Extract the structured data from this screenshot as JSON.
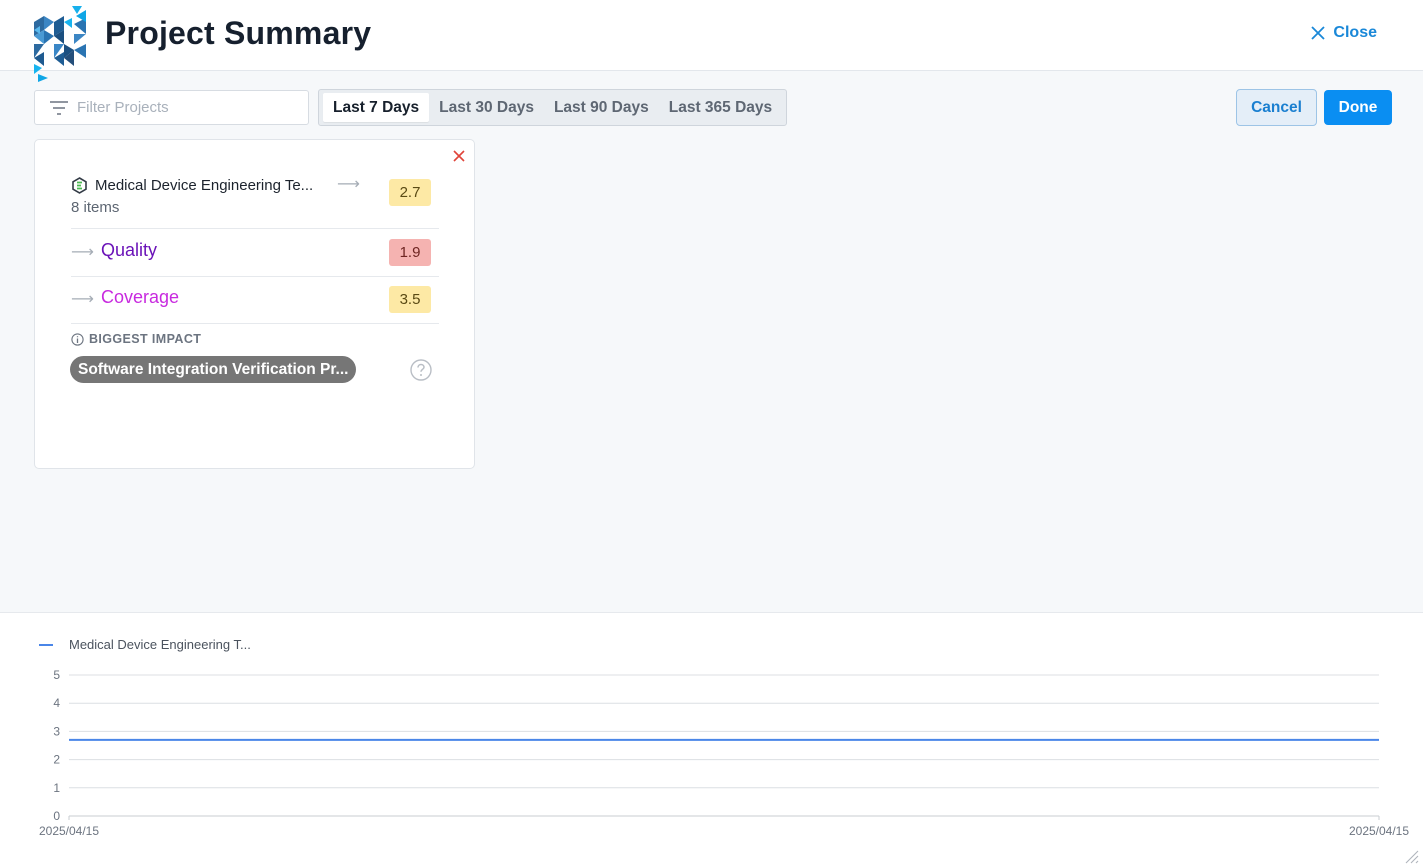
{
  "header": {
    "title": "Project Summary",
    "close_label": "Close"
  },
  "filter": {
    "placeholder": "Filter Projects",
    "value": ""
  },
  "ranges": [
    {
      "label": "Last 7 Days",
      "active": true
    },
    {
      "label": "Last 30 Days",
      "active": false
    },
    {
      "label": "Last 90 Days",
      "active": false
    },
    {
      "label": "Last 365 Days",
      "active": false
    }
  ],
  "actions": {
    "cancel_label": "Cancel",
    "done_label": "Done"
  },
  "card": {
    "project_name": "Medical Device Engineering Te...",
    "items": "8 items",
    "score": "2.7",
    "metrics": [
      {
        "label": "Quality",
        "score": "1.9"
      },
      {
        "label": "Coverage",
        "score": "3.5"
      }
    ],
    "impact_label": "BIGGEST IMPACT",
    "impact_value": "Software Integration Verification Pr..."
  },
  "colors": {
    "accent": "#0a8ef2",
    "series": "#4a86e8",
    "score_yellow": "#fde9a5",
    "score_red": "#f5b3b1",
    "quality": "#6a12b8",
    "coverage": "#c82adf"
  },
  "chart_data": {
    "type": "line",
    "series": [
      {
        "name": "Medical Device Engineering T...",
        "x": [
          "2025/04/15",
          "2025/04/15"
        ],
        "values": [
          2.7,
          2.7
        ]
      }
    ],
    "ylim": [
      0,
      5
    ],
    "yticks": [
      "0",
      "1",
      "2",
      "3",
      "4",
      "5"
    ],
    "xticks": [
      "2025/04/15",
      "2025/04/15"
    ],
    "grid": true,
    "legend": "top-left",
    "xlabel": "",
    "ylabel": ""
  }
}
